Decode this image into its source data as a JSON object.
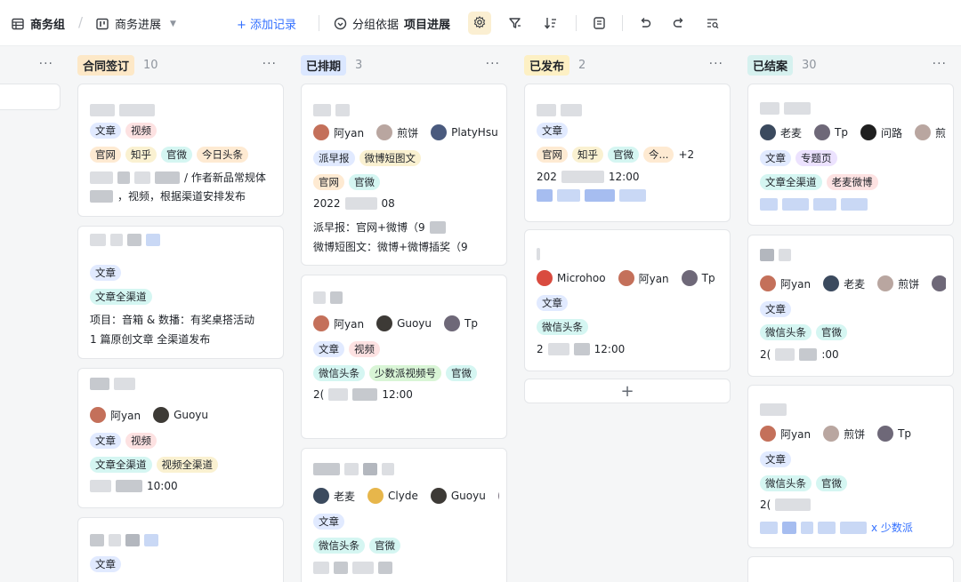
{
  "toolbar": {
    "workspace": "商务组",
    "view": "商务进展",
    "add_record": "+ 添加记录",
    "group_prefix": "分组依据",
    "group_field": "项目进展"
  },
  "columns": [
    {
      "status": "",
      "count": ""
    },
    {
      "status": "合同签订",
      "count": "10",
      "color": "#fde8c7"
    },
    {
      "status": "已排期",
      "count": "3",
      "color": "#dbe7ff"
    },
    {
      "status": "已发布",
      "count": "2",
      "color": "#fdf0c4"
    },
    {
      "status": "已结案",
      "count": "30",
      "color": "#d6f1ef"
    }
  ],
  "more": "···",
  "people": {
    "ayan": "阿yan",
    "jianbing": "煎饼",
    "platyhsu": "PlatyHsu",
    "guoyu": "Guoyu",
    "tp": "Tp",
    "laomai": "老麦",
    "clyde": "Clyde",
    "microhoo": "Microhoo",
    "wenlu": "问路",
    "jian": "煎"
  },
  "tags": {
    "wenzhang": "文章",
    "shipin": "视频",
    "guanwang": "官网",
    "zhihu": "知乎",
    "guanwei": "官微",
    "jinri": "今日头条",
    "wzqqd": "文章全渠道",
    "paizaobao": "派早报",
    "wbdtw": "微博短图文",
    "wxtt": "微信头条",
    "sspsph": "少数派视频号",
    "spqqd": "视频全渠道",
    "jin_ellipsis": "今...",
    "plus2": "+2",
    "zhuanti": "专题页",
    "lmwb": "老麦微博"
  },
  "texts": {
    "c1_card1_line1": "/ 作者新品常规体",
    "c1_card1_line2": "，视频，根据渠道安排发布",
    "c1_card2_line1": "项目：音箱 & 数播：有奖桌搭活动",
    "c1_card2_line2": "1 篇原创文章 全渠道发布",
    "c1_card3_time": "10:00",
    "c2_card1_date_a": "2022",
    "c2_card1_date_b": "08",
    "c2_card1_line1": "派早报：官网+微博（9",
    "c2_card1_line2": "微博短图文：微博+微博插奖（9",
    "c2_card2_date": "2(",
    "c2_card2_time": "12:00",
    "c3_card1_date": "202",
    "c3_card1_time": "12:00",
    "c3_card2_date": "2",
    "c3_card2_time": "12:00",
    "c4_card2_date": "2(",
    "c4_card2_time": ":00",
    "c4_card3_date": "2(",
    "c4_card3_link": "x 少数派"
  },
  "add_card": "+"
}
